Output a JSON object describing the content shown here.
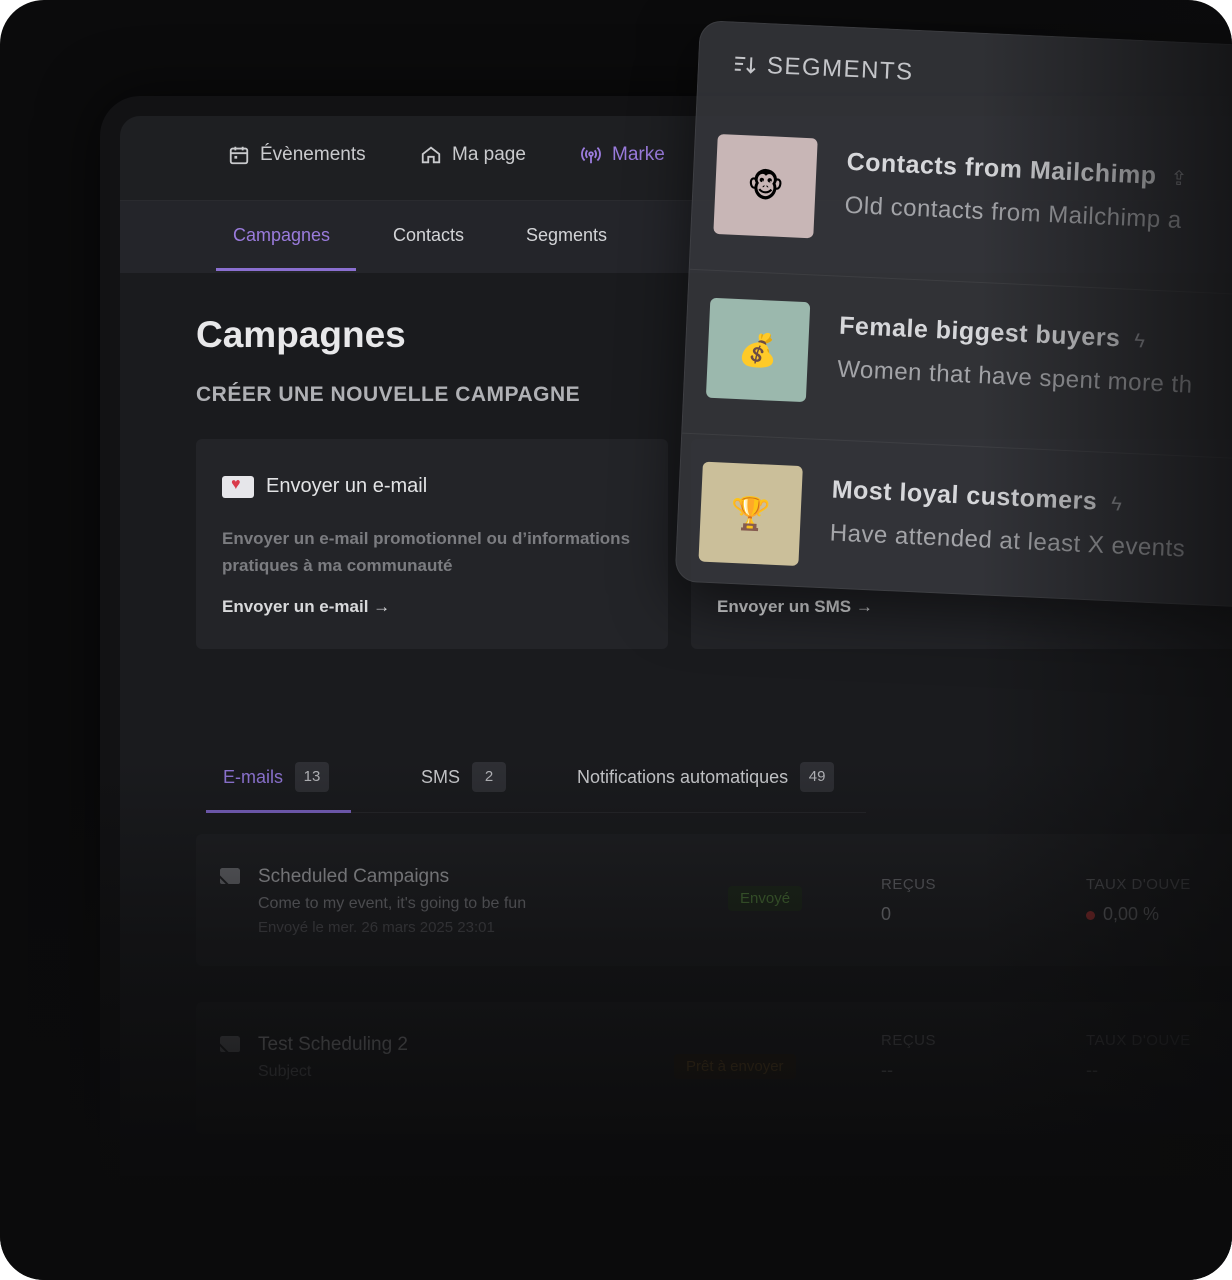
{
  "topnav": {
    "items": [
      {
        "label": "Évènements",
        "icon": "calendar-icon"
      },
      {
        "label": "Ma page",
        "icon": "home-icon"
      },
      {
        "label": "Marke",
        "icon": "broadcast-icon"
      }
    ]
  },
  "subnav": {
    "tabs": [
      {
        "label": "Campagnes"
      },
      {
        "label": "Contacts"
      },
      {
        "label": "Segments"
      }
    ]
  },
  "main": {
    "title": "Campagnes",
    "create_title": "CRÉER UNE NOUVELLE CAMPAGNE",
    "cards": [
      {
        "title": "Envoyer un e-mail",
        "description": "Envoyer un e-mail promotionnel ou d’informations pratiques à ma communauté",
        "link": "Envoyer un e-mail →",
        "icon": "envelope-heart-icon"
      },
      {
        "link": "Envoyer un SMS →"
      }
    ],
    "tabs": [
      {
        "label": "E-mails",
        "count": "13"
      },
      {
        "label": "SMS",
        "count": "2"
      },
      {
        "label": "Notifications automatiques",
        "count": "49"
      }
    ],
    "campaigns": [
      {
        "title": "Scheduled Campaigns",
        "subject": "Come to my event, it's going to be fun",
        "date": "Envoyé le mer. 26 mars 2025 23:01",
        "status": "Envoyé",
        "received_label": "REÇUS",
        "received_value": "0",
        "open_label": "TAUX D'OUVE",
        "open_value": "0,00 %"
      },
      {
        "title": "Test Scheduling 2",
        "subject": "Subject",
        "status": "Prêt à envoyer",
        "received_label": "REÇUS",
        "received_value": "--",
        "open_label": "TAUX D'OUVE",
        "open_value": "--"
      }
    ]
  },
  "segments_panel": {
    "title": "SEGMENTS",
    "items": [
      {
        "emoji": "🐵",
        "title": "Contacts from Mailchimp",
        "subtitle": "Old contacts from Mailchimp a",
        "icon": "upload-icon",
        "thumb_color": "#c8b6b6"
      },
      {
        "emoji": "💰",
        "title": "Female biggest buyers",
        "subtitle": "Women that have spent more th",
        "icon": "lightning-icon",
        "thumb_color": "#9bb8ad"
      },
      {
        "emoji": "🏆",
        "title": "Most loyal customers",
        "subtitle": "Have attended at least X events",
        "icon": "lightning-icon",
        "thumb_color": "#cbbf9a"
      }
    ]
  },
  "colors": {
    "accent": "#9a7bdc",
    "sent_badge": "#4e7a3a",
    "ready_badge": "#7a5a26"
  }
}
